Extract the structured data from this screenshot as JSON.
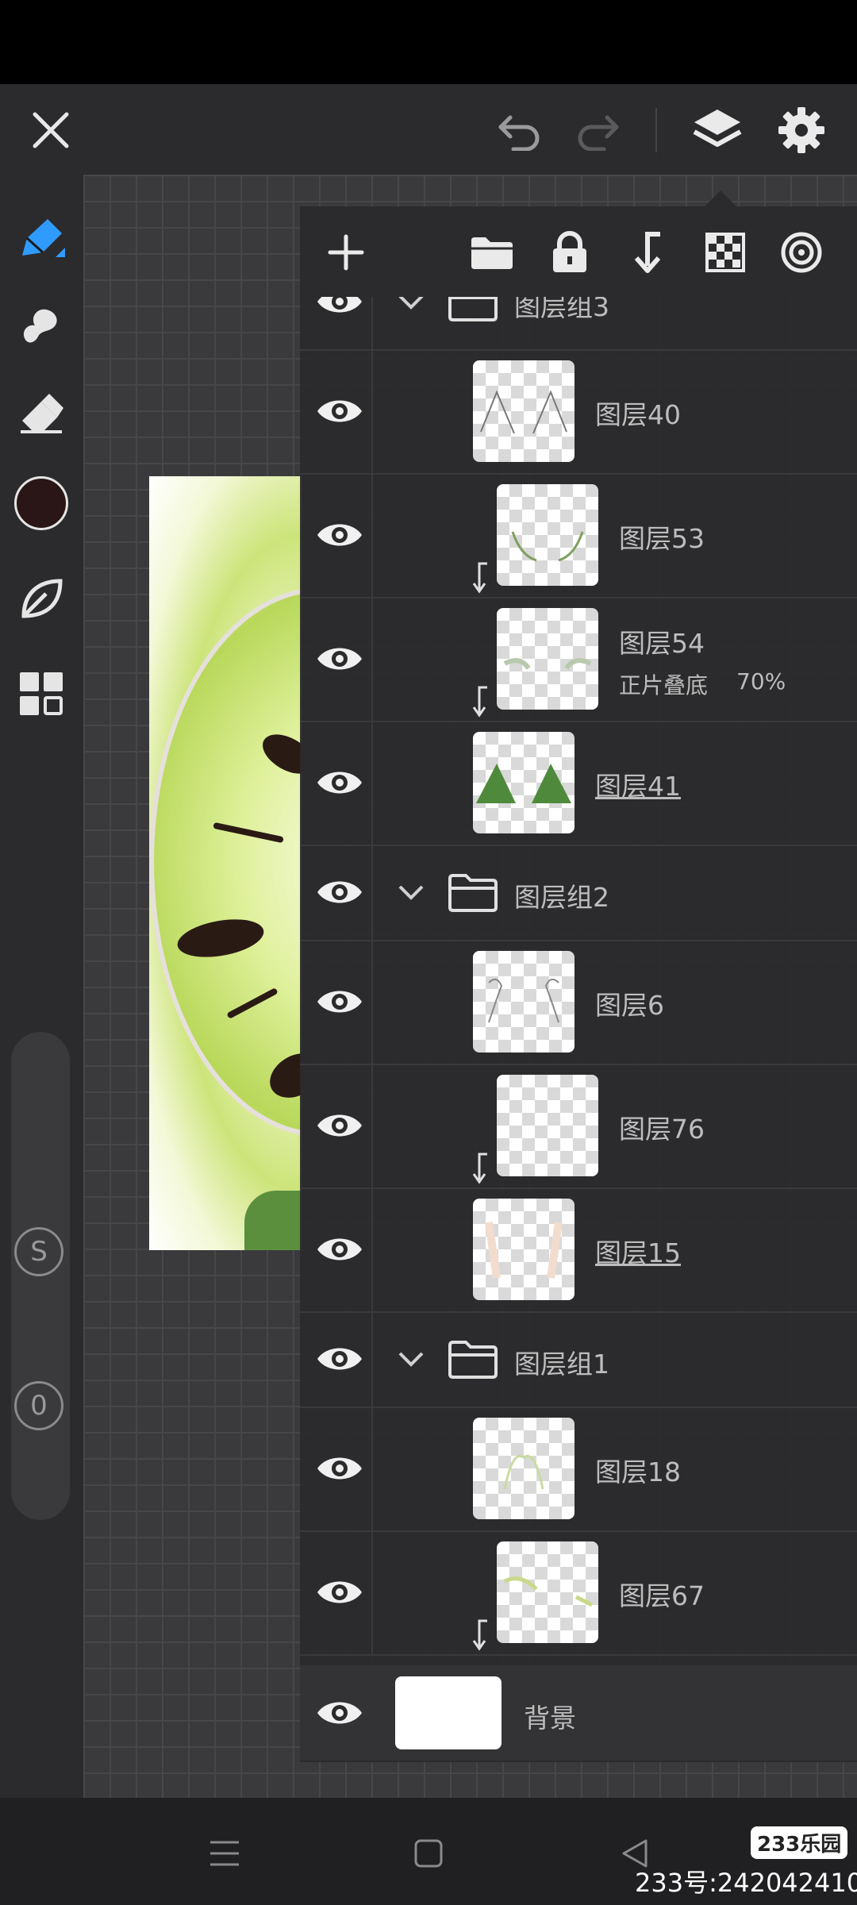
{
  "top_toolbar": {
    "close_icon": "close-icon",
    "undo_icon": "undo-icon",
    "redo_icon": "redo-icon",
    "layers_icon": "layers-icon",
    "settings_icon": "gear-icon"
  },
  "left_toolbar": {
    "tools": [
      "pen-icon",
      "smudge-icon",
      "eraser-icon",
      "color-swatch",
      "leaf-icon",
      "grid-icon"
    ],
    "current_color": "#2a1616",
    "size_slider_label": "S",
    "opacity_slider_label": "0"
  },
  "layer_panel": {
    "toolbar_icons": [
      "add-icon",
      "folder-icon",
      "lock-icon",
      "clip-arrow-icon",
      "checker-icon",
      "target-icon"
    ],
    "rows": [
      {
        "type": "group",
        "name": "图层组3"
      },
      {
        "type": "layer",
        "name": "图层40"
      },
      {
        "type": "layer",
        "name": "图层53",
        "clipped": true
      },
      {
        "type": "layer",
        "name": "图层54",
        "clipped": true,
        "blend_mode": "正片叠底",
        "opacity": "70%"
      },
      {
        "type": "layer",
        "name": "图层41",
        "selected": true
      },
      {
        "type": "group",
        "name": "图层组2"
      },
      {
        "type": "layer",
        "name": "图层6"
      },
      {
        "type": "layer",
        "name": "图层76",
        "clipped": true
      },
      {
        "type": "layer",
        "name": "图层15",
        "selected": true
      },
      {
        "type": "group",
        "name": "图层组1"
      },
      {
        "type": "layer",
        "name": "图层18"
      },
      {
        "type": "layer",
        "name": "图层67",
        "clipped": true
      },
      {
        "type": "background",
        "name": "背景"
      }
    ]
  },
  "bottom_nav": {
    "menu_icon": "menu-icon",
    "home_icon": "home-icon",
    "back_icon": "back-icon"
  },
  "watermark": {
    "badge": "233乐园",
    "id_text": "233号:242042410"
  },
  "colors": {
    "panel_bg": "#2b2b2d",
    "text": "#bdbdbd",
    "accent_blue": "#2f9bff",
    "thumb_green": "#4f8a3c"
  }
}
